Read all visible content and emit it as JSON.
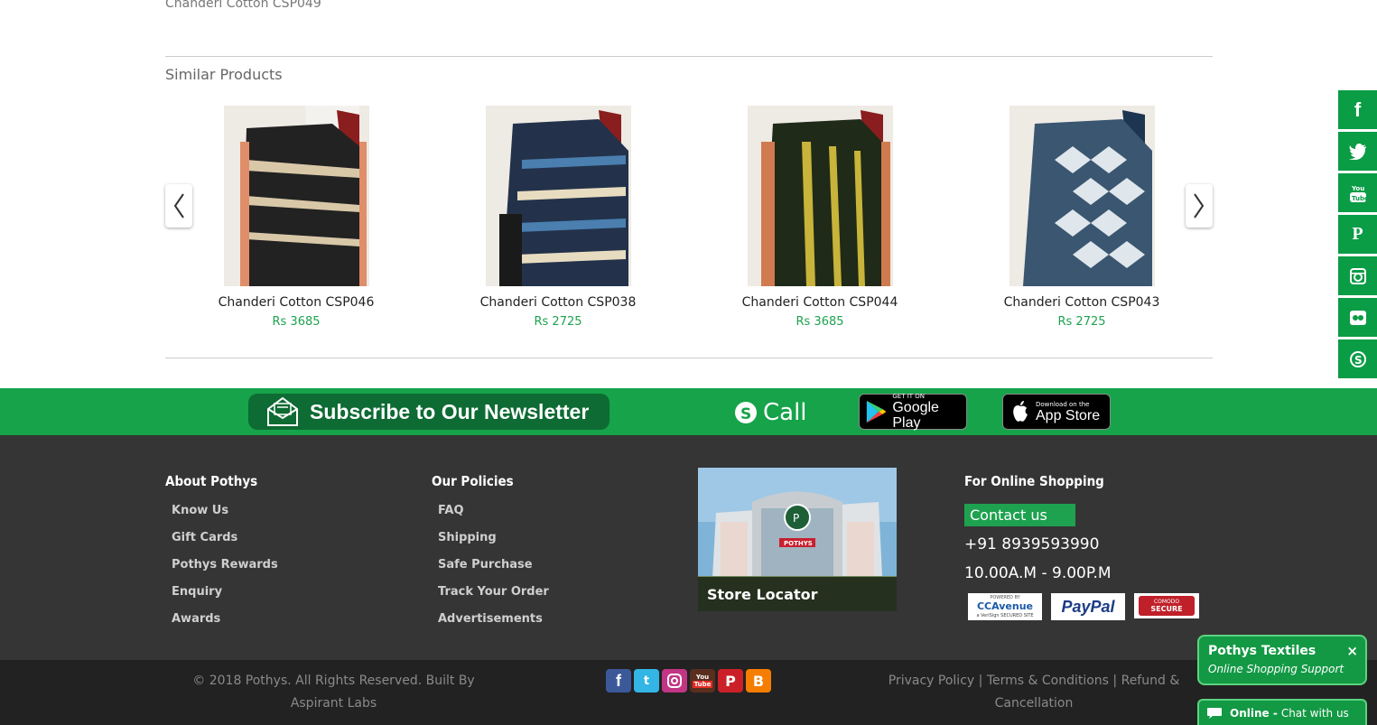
{
  "breadcrumb_product": "Chanderi Cotton CSP049",
  "similar": {
    "title": "Similar Products",
    "products": [
      {
        "name": "Chanderi Cotton CSP046",
        "price": "Rs 3685"
      },
      {
        "name": "Chanderi Cotton CSP038",
        "price": "Rs 2725"
      },
      {
        "name": "Chanderi Cotton CSP044",
        "price": "Rs 3685"
      },
      {
        "name": "Chanderi Cotton CSP043",
        "price": "Rs 2725"
      }
    ]
  },
  "banner": {
    "newsletter": "Subscribe to Our Newsletter",
    "call": "Call",
    "google_small": "GET IT ON",
    "google_big": "Google Play",
    "apple_small": "Download on the",
    "apple_big": "App Store"
  },
  "footer": {
    "about": {
      "title": "About Pothys",
      "links": [
        "Know Us",
        "Gift Cards",
        "Pothys Rewards",
        "Enquiry",
        "Awards"
      ]
    },
    "policies": {
      "title": "Our Policies",
      "links": [
        "FAQ",
        "Shipping",
        "Safe Purchase",
        "Track Your Order",
        "Advertisements"
      ]
    },
    "store_locator": "Store Locator",
    "store_sign": "POTHYS",
    "online": {
      "title": "For Online Shopping",
      "contact": "Contact us",
      "phone": "+91 8939593990",
      "hours": "10.00A.M - 9.00P.M"
    },
    "payments": {
      "ccavenue": "CCAvenue",
      "ccavenue_top": "POWERED BY",
      "ccavenue_sub": "a VeriSign SECURED SITE",
      "paypal": "PayPal",
      "comodo_top": "COMODO",
      "comodo": "SECURE"
    }
  },
  "bottom": {
    "copyright": "© 2018 Pothys. All Rights Reserved. Built By Aspirant Labs",
    "privacy": "Privacy Policy",
    "terms": "Terms & Conditions",
    "refund": "Refund & Cancellation",
    "sep": "|"
  },
  "chat": {
    "title": "Pothys Textiles",
    "subtitle": "Online Shopping Support",
    "close": "×",
    "status": "Online -",
    "action": "Chat with us"
  },
  "colors": {
    "brand_green": "#16a34a",
    "price_green": "#1ea24f",
    "footer_bg": "#353535",
    "bottom_bg": "#222222"
  }
}
